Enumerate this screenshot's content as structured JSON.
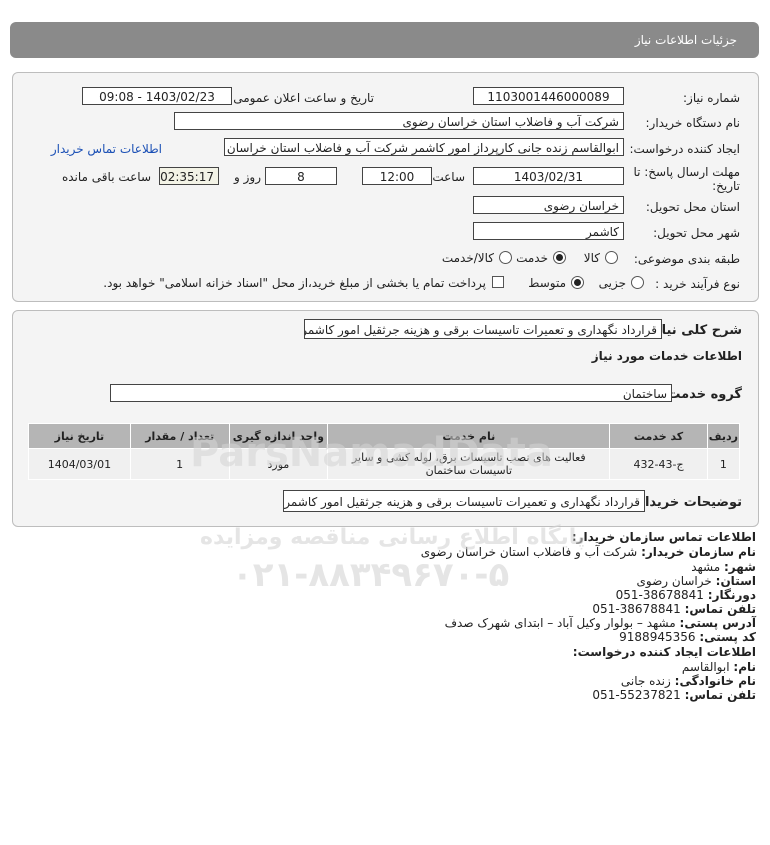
{
  "header": {
    "title": "جزئیات اطلاعات نیاز"
  },
  "need": {
    "number_label": "شماره نیاز:",
    "number": "1103001446000089",
    "announce_label": "تاریخ و ساعت اعلان عمومی:",
    "announce_value": "1403/02/23 - 09:08",
    "buyer_label": "نام دستگاه خریدار:",
    "buyer": "شرکت آب و فاضلاب استان خراسان رضوی",
    "creator_label": "ایجاد کننده درخواست:",
    "creator": "ابوالقاسم زنده جانی کارپرداز امور کاشمر  شرکت آب و فاضلاب استان خراسان رضوی",
    "contact_link": "اطلاعات تماس خریدار",
    "deadline_label_1": "مهلت ارسال پاسخ: تا",
    "deadline_label_2": "تاریخ:",
    "deadline_date": "1403/02/31",
    "time_label": "ساعت",
    "deadline_time": "12:00",
    "days": "8",
    "days_label": "روز و",
    "remaining": "02:35:17",
    "remaining_label": "ساعت باقی مانده",
    "province_label": "استان محل تحویل:",
    "province": "خراسان رضوی",
    "city_label": "شهر محل تحویل:",
    "city": "کاشمر",
    "category_label": "طبقه بندی موضوعی:",
    "category_options": [
      "کالا",
      "خدمت",
      "کالا/خدمت"
    ],
    "category_selected": "خدمت",
    "process_label": "نوع فرآیند خرید :",
    "process_options": [
      "جزیی",
      "متوسط"
    ],
    "process_selected": "متوسط",
    "treasury_note": "پرداخت تمام یا بخشی از مبلغ خرید،از محل \"اسناد خزانه اسلامی\" خواهد بود."
  },
  "details": {
    "desc_label": "شرح کلی نیاز:",
    "desc": "قرارداد نگهداری و تعمیرات تاسیسات برقی و هزینه جرثقیل امور کاشمر",
    "services_title": "اطلاعات خدمات مورد نیاز",
    "group_label": "گروه خدمت:",
    "group": "ساختمان",
    "table": {
      "headers": [
        "ردیف",
        "کد خدمت",
        "نام خدمت",
        "واحد اندازه گیری",
        "تعداد / مقدار",
        "تاریخ نیاز"
      ],
      "rows": [
        [
          "1",
          "ج-43-432",
          "فعالیت های نصب تاسیسات برق، لوله کشی و سایر تاسیسات ساختمان",
          "مورد",
          "1",
          "1404/03/01"
        ]
      ]
    },
    "buyer_notes_label": "توضیحات خریدار:",
    "buyer_notes": "قرارداد نگهداری و تعمیرات تاسیسات برقی و هزینه جرثقیل امور کاشمر"
  },
  "contact": {
    "title": "اطلاعات تماس سازمان خریدار:",
    "org_label": "نام سازمان خریدار:",
    "org": "شرکت آب و فاضلاب استان خراسان رضوی",
    "city_label": "شهر:",
    "city": "مشهد",
    "province_label": "استان:",
    "province": "خراسان رضوی",
    "fax_label": "دورنگار:",
    "fax": "051-38678841",
    "phone_label": "تلفن تماس:",
    "phone": "051-38678841",
    "address_label": "آدرس پستی:",
    "address": "مشهد – بولوار وکیل آباد – ابتدای شهرک صدف",
    "postal_label": "کد پستی:",
    "postal": "9188945356",
    "creator_title": "اطلاعات ایجاد کننده درخواست:",
    "first_name_label": "نام:",
    "first_name": "ابوالقاسم",
    "last_name_label": "نام خانوادگی:",
    "last_name": "زنده جانی",
    "creator_phone_label": "تلفن تماس:",
    "creator_phone": "051-55237821"
  },
  "watermark": {
    "line1": "پایگاه اطلاع رسانی مناقصه ومزایده",
    "line2": "۰۲۱-۸۸۳۴۹۶۷۰-۵",
    "brand": "ParsNamadData"
  }
}
